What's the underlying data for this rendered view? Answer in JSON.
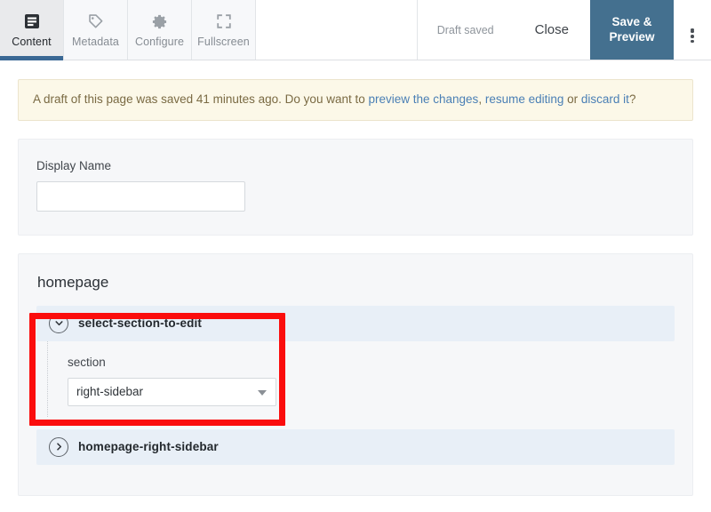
{
  "toolbar": {
    "tabs": [
      {
        "label": "Content",
        "icon": "document-lines-icon",
        "active": true
      },
      {
        "label": "Metadata",
        "icon": "tag-icon",
        "active": false
      },
      {
        "label": "Configure",
        "icon": "gear-icon",
        "active": false
      },
      {
        "label": "Fullscreen",
        "icon": "fullscreen-icon",
        "active": false
      }
    ],
    "draft_status": "Draft saved",
    "close_label": "Close",
    "save_label": "Save & Preview",
    "overflow_icon": "kebab-menu-icon",
    "accent_color": "#44708f",
    "active_tab_underline_color": "#3a6894"
  },
  "banner": {
    "text_before": "A draft of this page was saved 41 minutes ago. Do you want to ",
    "link_preview": "preview the changes",
    "separator_1": ", ",
    "link_resume": "resume editing",
    "separator_2": " or ",
    "link_discard": "discard it",
    "text_after": "?",
    "background_color": "#fcf8e8",
    "link_color": "#4a7fb5"
  },
  "display_panel": {
    "label": "Display Name",
    "value": "",
    "placeholder": ""
  },
  "sections_panel": {
    "title": "homepage",
    "accordions": [
      {
        "title": "select-section-to-edit",
        "expanded": true,
        "chevron_icon": "chevron-down-icon",
        "highlighted": true,
        "field": {
          "label": "section",
          "selected": "right-sidebar",
          "options": [
            "right-sidebar"
          ]
        }
      },
      {
        "title": "homepage-right-sidebar",
        "expanded": false,
        "chevron_icon": "chevron-right-icon",
        "highlighted": false
      }
    ],
    "row_background_color": "#e8eff7"
  },
  "annotation": {
    "highlight_color": "#fb0d0d"
  }
}
